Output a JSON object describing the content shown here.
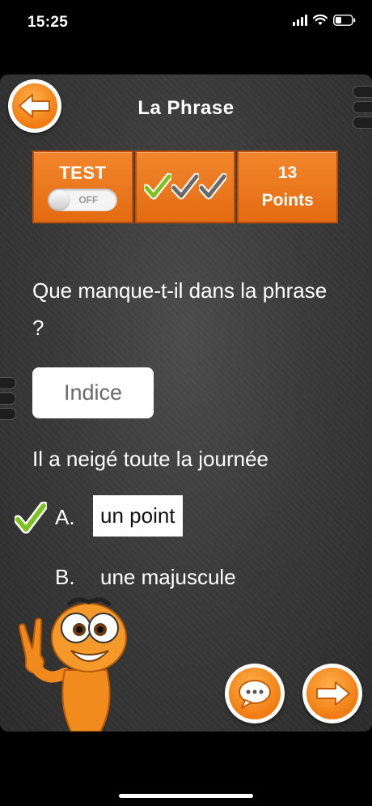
{
  "status_bar": {
    "time": "15:25"
  },
  "header": {
    "title": "La Phrase"
  },
  "scorebar": {
    "test_label": "TEST",
    "toggle_state": "OFF",
    "checks": [
      "green",
      "gray",
      "gray"
    ],
    "points_value": "13",
    "points_label": "Points"
  },
  "question": {
    "text": "Que manque-t-il dans la phrase ?"
  },
  "hint": {
    "label": "Indice"
  },
  "sentence": "Il a neigé toute la journée",
  "answers": [
    {
      "letter": "A.",
      "text": "un point",
      "selected": true,
      "correct": true
    },
    {
      "letter": "B.",
      "text": "une majuscule",
      "selected": false,
      "correct": false
    }
  ],
  "colors": {
    "accent": "#f07c12",
    "check_green": "#7dc21e",
    "background": "#3a3a3a"
  },
  "icons": [
    "back-arrow-icon",
    "speech-bubble-icon",
    "next-arrow-icon",
    "checkmark-icon"
  ]
}
